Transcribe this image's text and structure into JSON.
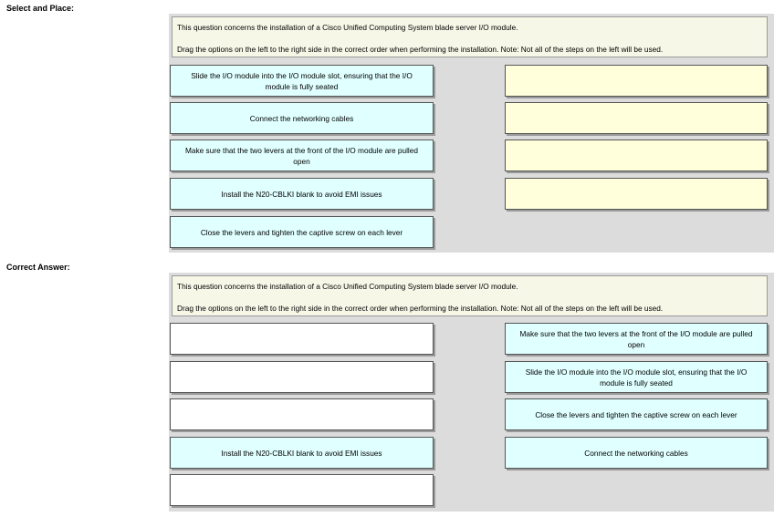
{
  "select_and_place": {
    "heading": "Select and Place:",
    "instruction_line1": "This question concerns the installation of a Cisco Unified Computing System blade server I/O module.",
    "instruction_line2": "Drag the options on the left to the right side in the correct order when performing the installation. Note: Not all of the steps on the left will be used.",
    "source_items": [
      "Slide the I/O module into the I/O module slot, ensuring that the I/O module is fully seated",
      "Connect the networking cables",
      "Make sure that the two levers at the front of the I/O module are pulled open",
      "Install the N20-CBLKI blank to avoid EMI issues",
      "Close the levers and tighten the captive screw on each lever"
    ],
    "target_slots": [
      "",
      "",
      "",
      ""
    ]
  },
  "correct_answer": {
    "heading": "Correct Answer:",
    "instruction_line1": "This question concerns the installation of a Cisco Unified Computing System blade server I/O module.",
    "instruction_line2": "Drag the options on the left to the right side in the correct order when performing the installation. Note: Not all of the steps on the left will be used.",
    "source_items": [
      "",
      "",
      "",
      "Install the N20-CBLKI blank to avoid EMI issues",
      ""
    ],
    "target_slots": [
      "Make sure that the two levers at the front of the I/O module are pulled open",
      "Slide the I/O module into the I/O module slot, ensuring that the I/O module is fully seated",
      "Close the levers and tighten the captive screw on each lever",
      "Connect the networking cables"
    ]
  },
  "colors": {
    "panel_bg": "#dcdcdc",
    "instruction_bg": "#f7f7e8",
    "option_bg": "#e0ffff",
    "empty_target_bg": "#ffffdc"
  }
}
